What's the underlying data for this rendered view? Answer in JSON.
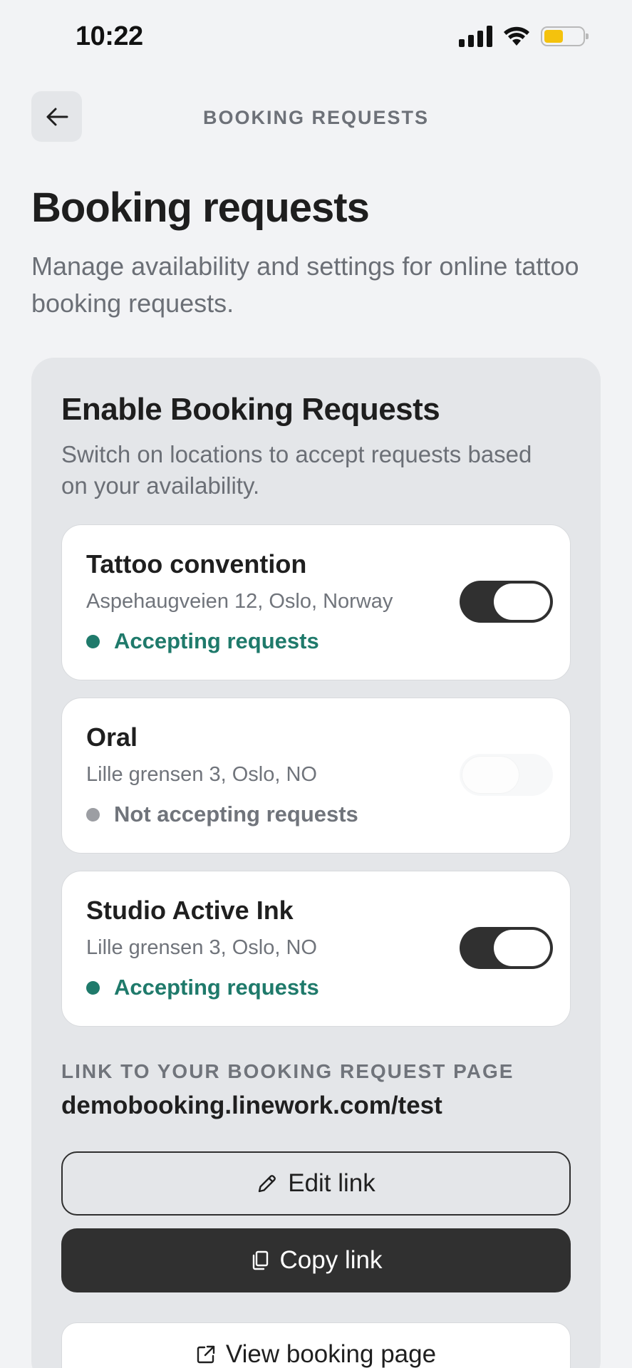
{
  "status_bar": {
    "time": "10:22",
    "icons": [
      "cellular-signal-icon",
      "wifi-icon",
      "battery-icon"
    ],
    "battery_color": "#f4c20d"
  },
  "nav": {
    "back_icon": "arrow-left-icon",
    "title": "BOOKING REQUESTS"
  },
  "header": {
    "title": "Booking requests",
    "subtitle": "Manage availability and settings for online tattoo booking requests."
  },
  "booking_card": {
    "title": "Enable Booking Requests",
    "subtitle": "Switch on locations to accept requests based on your availability.",
    "locations": [
      {
        "name": "Tattoo convention",
        "address": "Aspehaugveien 12, Oslo, Norway",
        "status": "Accepting requests",
        "enabled": true
      },
      {
        "name": "Oral",
        "address": "Lille grensen 3, Oslo, NO",
        "status": "Not accepting requests",
        "enabled": false
      },
      {
        "name": "Studio Active Ink",
        "address": "Lille grensen 3, Oslo, NO",
        "status": "Accepting requests",
        "enabled": true
      }
    ],
    "link_label": "LINK TO YOUR BOOKING REQUEST PAGE",
    "link_url": "demobooking.linework.com/test",
    "edit_label": "Edit link",
    "copy_label": "Copy link",
    "view_label": "View booking page"
  },
  "colors": {
    "accent_green": "#1f7a6b",
    "toggle_on": "#303030",
    "muted_dot": "#9c9ea3"
  }
}
